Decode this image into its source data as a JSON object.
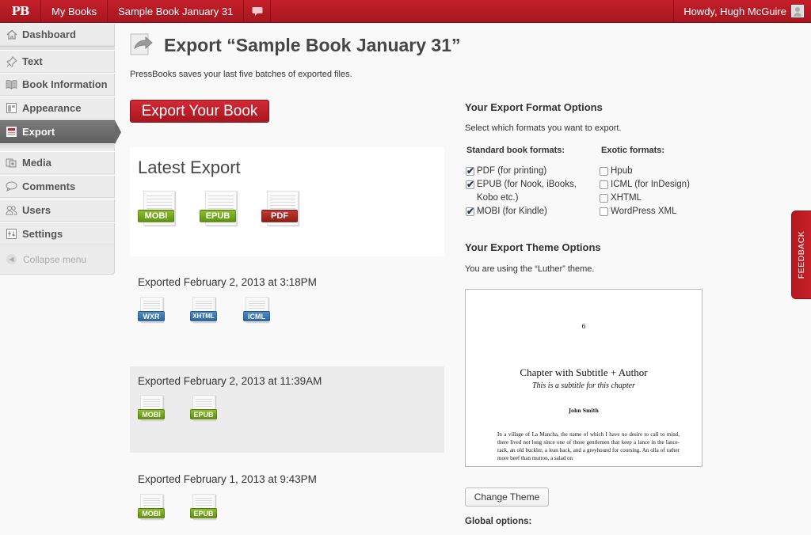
{
  "adminbar": {
    "logo": "PB",
    "my_books": "My Books",
    "book_name": "Sample Book January 31",
    "comments_icon": "speech-bubble-icon",
    "howdy": "Howdy, Hugh McGuire"
  },
  "sidebar": {
    "items": [
      {
        "label": "Dashboard",
        "icon": "home-icon"
      },
      {
        "label": "Text",
        "icon": "pin-icon"
      },
      {
        "label": "Book Information",
        "icon": "book-icon"
      },
      {
        "label": "Appearance",
        "icon": "layout-icon"
      },
      {
        "label": "Export",
        "icon": "export-icon",
        "active": true
      },
      {
        "label": "Media",
        "icon": "media-icon"
      },
      {
        "label": "Comments",
        "icon": "comment-icon"
      },
      {
        "label": "Users",
        "icon": "users-icon"
      },
      {
        "label": "Settings",
        "icon": "settings-icon"
      }
    ],
    "collapse": "Collapse menu"
  },
  "page": {
    "title": "Export “Sample Book January 31”",
    "intro": "PressBooks saves your last five batches of exported files.",
    "export_button": "Export Your Book"
  },
  "latest": {
    "title": "Latest Export",
    "files": [
      "MOBI",
      "EPUB",
      "PDF"
    ]
  },
  "exports": [
    {
      "date": "Exported February 2, 2013 at 3:18PM",
      "files": [
        "WXR",
        "XHTML",
        "ICML"
      ]
    },
    {
      "date": "Exported February 2, 2013 at 11:39AM",
      "files": [
        "MOBI",
        "EPUB"
      ]
    },
    {
      "date": "Exported February 1, 2013 at 9:43PM",
      "files": [
        "MOBI",
        "EPUB"
      ]
    }
  ],
  "format_options": {
    "heading": "Your Export Format Options",
    "desc": "Select which formats you want to export.",
    "standard_heading": "Standard book formats:",
    "exotic_heading": "Exotic formats:",
    "standard": [
      {
        "label": "PDF (for printing)",
        "checked": true
      },
      {
        "label": "EPUB (for Nook, iBooks, Kobo etc.)",
        "checked": true
      },
      {
        "label": "MOBI (for Kindle)",
        "checked": true
      }
    ],
    "exotic": [
      {
        "label": "Hpub",
        "checked": false
      },
      {
        "label": "ICML (for InDesign)",
        "checked": false
      },
      {
        "label": "XHTML",
        "checked": false
      },
      {
        "label": "WordPress XML",
        "checked": false
      }
    ]
  },
  "theme_options": {
    "heading": "Your Export Theme Options",
    "desc": "You are using the “Luther” theme.",
    "preview": {
      "page_number": "6",
      "chapter_title": "Chapter with Subtitle + Author",
      "subtitle": "This is a subtitle for this chapter",
      "author": "John Smith",
      "body": "In a village of La Mancha, the name of which I have no desire to call to mind, there lived not long since one of those gentlemen that keep a lance in the lance-rack, an old buckler, a lean hack, and a greyhound for coursing. An olla of rather more beef than mutton, a salad on"
    },
    "change_button": "Change Theme",
    "global_options": "Global options:"
  },
  "feedback_label": "FEEDBACK",
  "colors": {
    "brand_red": "#a8161f",
    "mobi_green": "#6fa31c",
    "pdf_red": "#a52a22",
    "xml_blue": "#3b78b4"
  }
}
